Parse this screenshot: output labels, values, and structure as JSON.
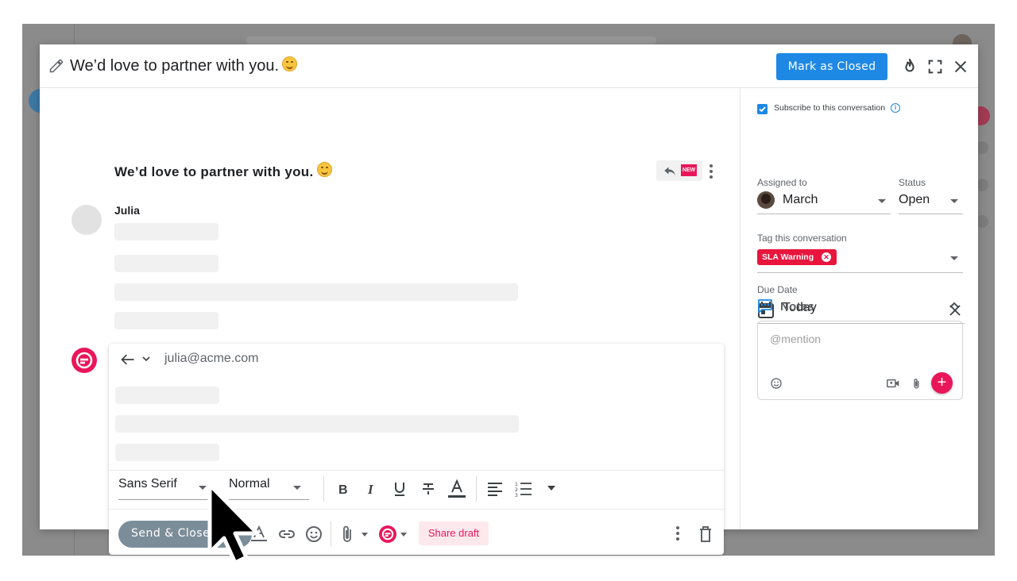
{
  "window": {
    "title": "We’d love to partner with you.",
    "mark_closed_label": "Mark as Closed"
  },
  "thread": {
    "subject": "We’d love to partner with you.",
    "new_badge": "NEW",
    "sender_name": "Julia"
  },
  "composer": {
    "to_email": "julia@acme.com",
    "font_family": "Sans Serif",
    "font_size": "Normal",
    "send_label": "Send & Close",
    "share_draft_label": "Share draft"
  },
  "sidebar": {
    "subscribe_label": "Subscribe to this conversation",
    "subscribed": true,
    "assigned_label": "Assigned to",
    "assignee": "March",
    "status_label": "Status",
    "status_value": "Open",
    "tag_label": "Tag this conversation",
    "tags": [
      "SLA Warning"
    ],
    "due_label": "Due Date",
    "due_value": "Today",
    "notes_title": "Notes",
    "notes_placeholder": "@mention"
  },
  "colors": {
    "brand": "#e9165a",
    "primary": "#1e88e5",
    "tag": "#e8153c",
    "send_button": "#7b8d99"
  }
}
